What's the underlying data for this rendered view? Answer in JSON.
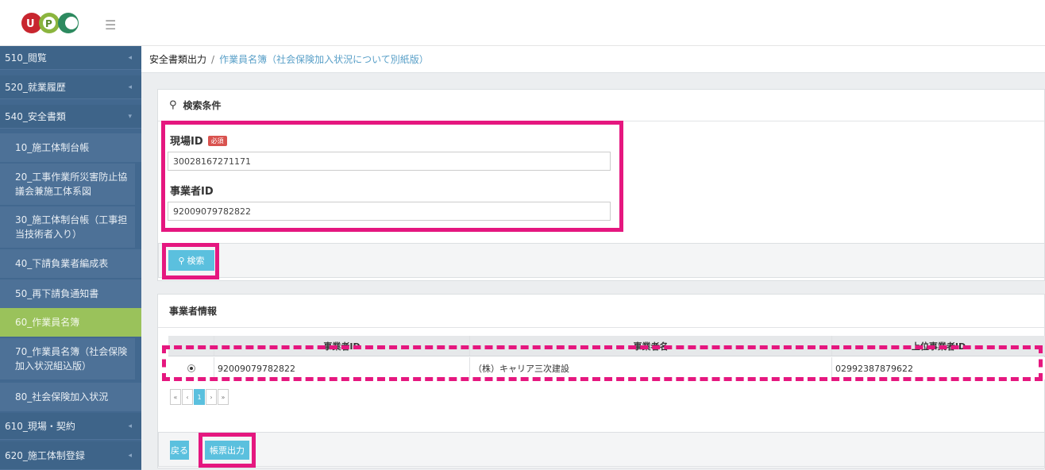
{
  "header": {
    "logo_text": "UPC",
    "menu_icon": "hamburger-icon"
  },
  "sidebar": {
    "items": [
      {
        "label": "510_閲覧"
      },
      {
        "label": "520_就業履歴"
      },
      {
        "label": "540_安全書類"
      },
      {
        "label": "10_施工体制台帳"
      },
      {
        "label": "20_工事作業所災害防止協議会兼施工体系図"
      },
      {
        "label": "30_施工体制台帳（工事担当技術者入り）"
      },
      {
        "label": "40_下請負業者編成表"
      },
      {
        "label": "50_再下請負通知書"
      },
      {
        "label": "60_作業員名簿"
      },
      {
        "label": "70_作業員名簿（社会保険加入状況組込版）"
      },
      {
        "label": "80_社会保険加入状況"
      },
      {
        "label": "610_現場・契約"
      },
      {
        "label": "620_施工体制登録"
      }
    ]
  },
  "breadcrumb": {
    "root": "安全書類出力",
    "separator": "/",
    "current": "作業員名簿（社会保険加入状況について別紙版）"
  },
  "search": {
    "title": "検索条件",
    "site_id_label": "現場ID",
    "required_badge": "必須",
    "site_id_value": "30028167271171",
    "company_id_label": "事業者ID",
    "company_id_value": "92009079782822",
    "search_button": "検索"
  },
  "company_info": {
    "title": "事業者情報",
    "columns": [
      "事業者ID",
      "事業者名",
      "上位事業者ID"
    ],
    "rows": [
      {
        "id": "92009079782822",
        "name": "（株）キャリア三次建設",
        "parent_id": "02992387879622"
      }
    ],
    "pager": [
      "«",
      "‹",
      "1",
      "›",
      "»"
    ]
  },
  "actions": {
    "back": "戻る",
    "print": "帳票出力"
  },
  "colors": {
    "sidebar": "#42688f",
    "active": "#9ac25b",
    "accent": "#5bc0de",
    "highlight": "#e5177f"
  }
}
